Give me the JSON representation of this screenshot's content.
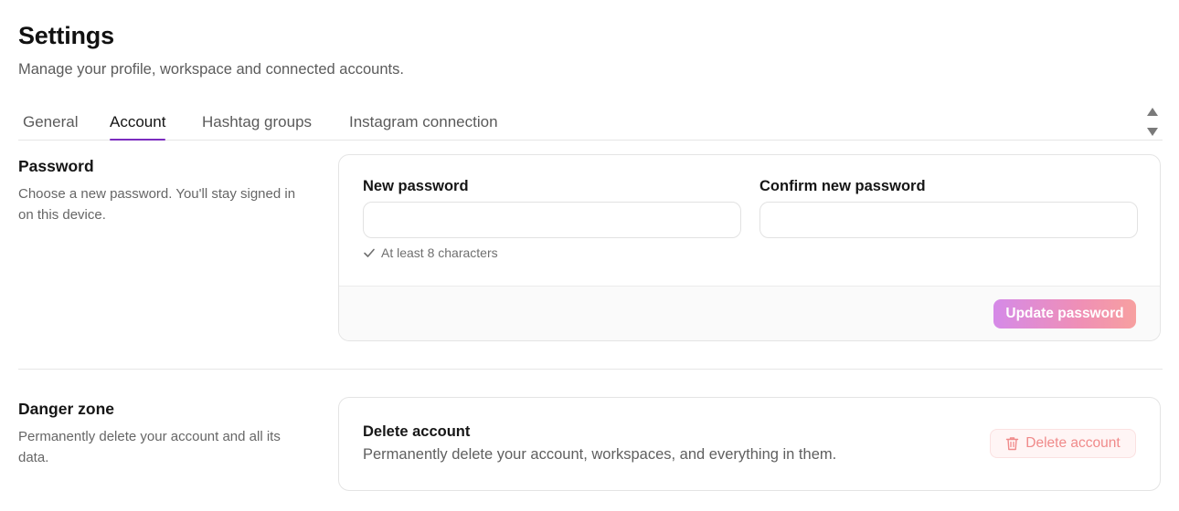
{
  "header": {
    "title": "Settings",
    "subtitle": "Manage your profile, workspace and connected accounts."
  },
  "tabs": [
    {
      "label": "General",
      "active": false
    },
    {
      "label": "Account",
      "active": true
    },
    {
      "label": "Hashtag groups",
      "active": false
    },
    {
      "label": "Instagram connection",
      "active": false
    }
  ],
  "password_section": {
    "title": "Password",
    "description": "Choose a new password. You'll stay signed in on this device.",
    "new_password_label": "New password",
    "new_password_value": "",
    "confirm_password_label": "Confirm new password",
    "confirm_password_value": "",
    "hint": "At least 8 characters",
    "submit_label": "Update password"
  },
  "danger_section": {
    "title": "Danger zone",
    "description": "Permanently delete your account and all its data.",
    "card_title": "Delete account",
    "card_description": "Permanently delete your account, workspaces, and everything in them.",
    "delete_label": "Delete account"
  },
  "icons": {
    "scroll": "scroll-arrows-icon",
    "hint": "check-icon",
    "delete": "trash-icon"
  },
  "colors": {
    "accent": "#7b2cbf",
    "update_gradient_start": "#d58ae8",
    "update_gradient_end": "#f7a0a0",
    "danger_text": "#f08a8a",
    "danger_bg": "#fff5f5"
  }
}
